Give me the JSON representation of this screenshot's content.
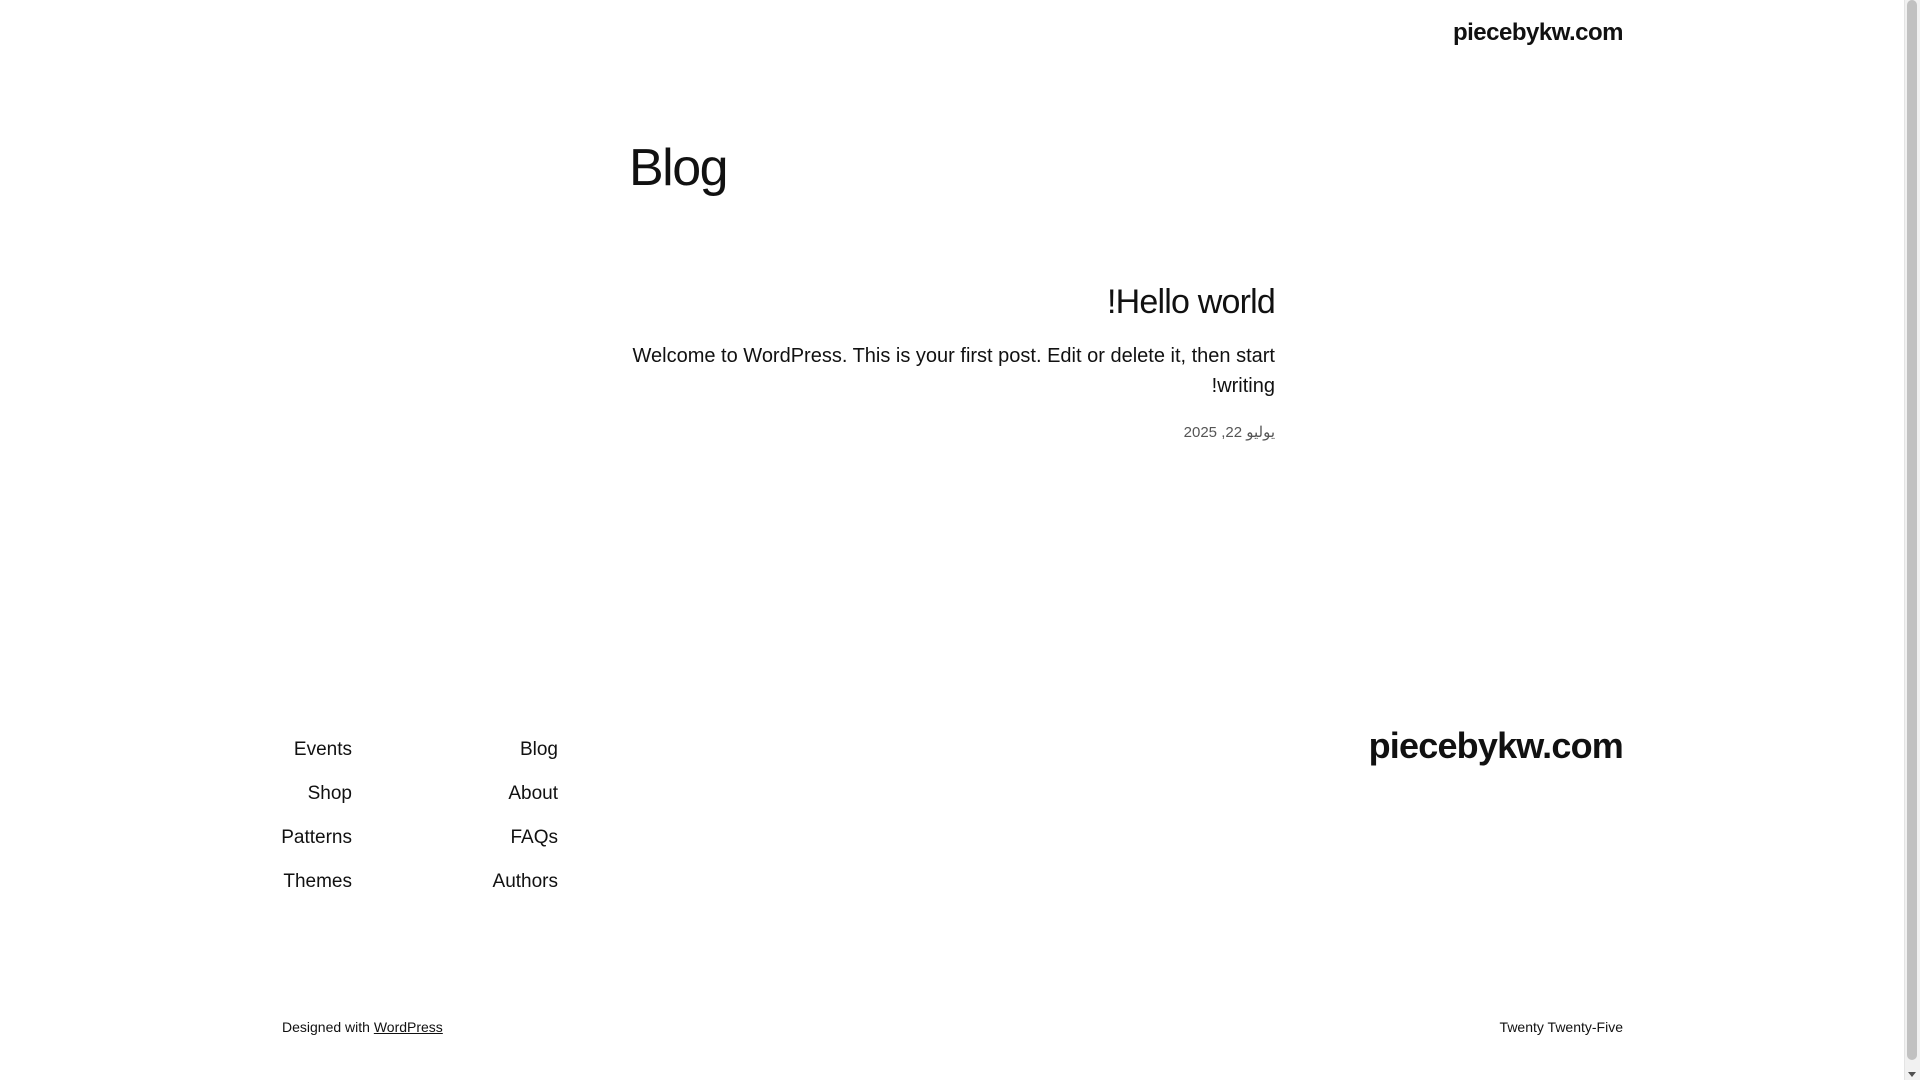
{
  "header": {
    "site_title": "piecebykw.com"
  },
  "main": {
    "heading": "Blog",
    "posts": [
      {
        "title": "Hello world!",
        "excerpt": "Welcome to WordPress. This is your first post. Edit or delete it, then start writing!",
        "date": "يوليو 22, 2025"
      }
    ]
  },
  "footer": {
    "nav_column_1": [
      "Events",
      "Shop",
      "Patterns",
      "Themes"
    ],
    "nav_column_2": [
      "Blog",
      "About",
      "FAQs",
      "Authors"
    ],
    "site_title": "piecebykw.com",
    "credit_prefix": "Designed with",
    "credit_link": "WordPress",
    "theme_name": "Twenty Twenty-Five"
  }
}
